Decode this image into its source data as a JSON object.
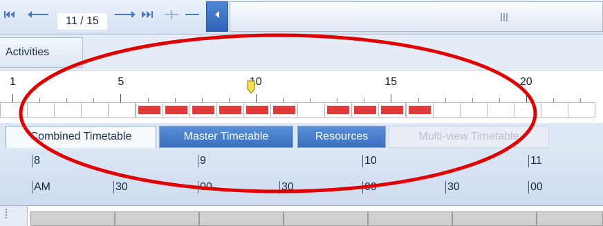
{
  "navigator": {
    "first_icon": "first-page-icon",
    "prev_icon": "previous-page-icon",
    "counter": "11 / 15",
    "next_icon": "next-page-icon",
    "last_icon": "last-page-icon",
    "add_icon": "plus-icon",
    "remove_icon": "minus-icon",
    "scroll_left_icon": "scroll-left-icon"
  },
  "activities_tab": {
    "label": "Activities"
  },
  "ruler": {
    "labels": [
      "1",
      "5",
      "10",
      "15",
      "20"
    ],
    "current_page": 10
  },
  "cells": {
    "count": 22,
    "filled": [
      5,
      6,
      7,
      8,
      9,
      10,
      12,
      13,
      14,
      15
    ]
  },
  "timetable_tabs": [
    {
      "label": "Combined Timetable",
      "state": "active"
    },
    {
      "label": "Master Timetable",
      "state": "normal"
    },
    {
      "label": "Resources",
      "state": "normal"
    },
    {
      "label": "Multi-view Timetable",
      "state": "disabled"
    }
  ],
  "time_header": {
    "hours": [
      "8",
      "9",
      "10",
      "11"
    ],
    "am_label": "AM",
    "minutes": [
      "30",
      "00",
      "30",
      "00",
      "30",
      "00"
    ]
  },
  "colors": {
    "annotation": "#e00000",
    "filled_cell": "#e23a3a",
    "tab_blue": "#3a6fbf"
  }
}
